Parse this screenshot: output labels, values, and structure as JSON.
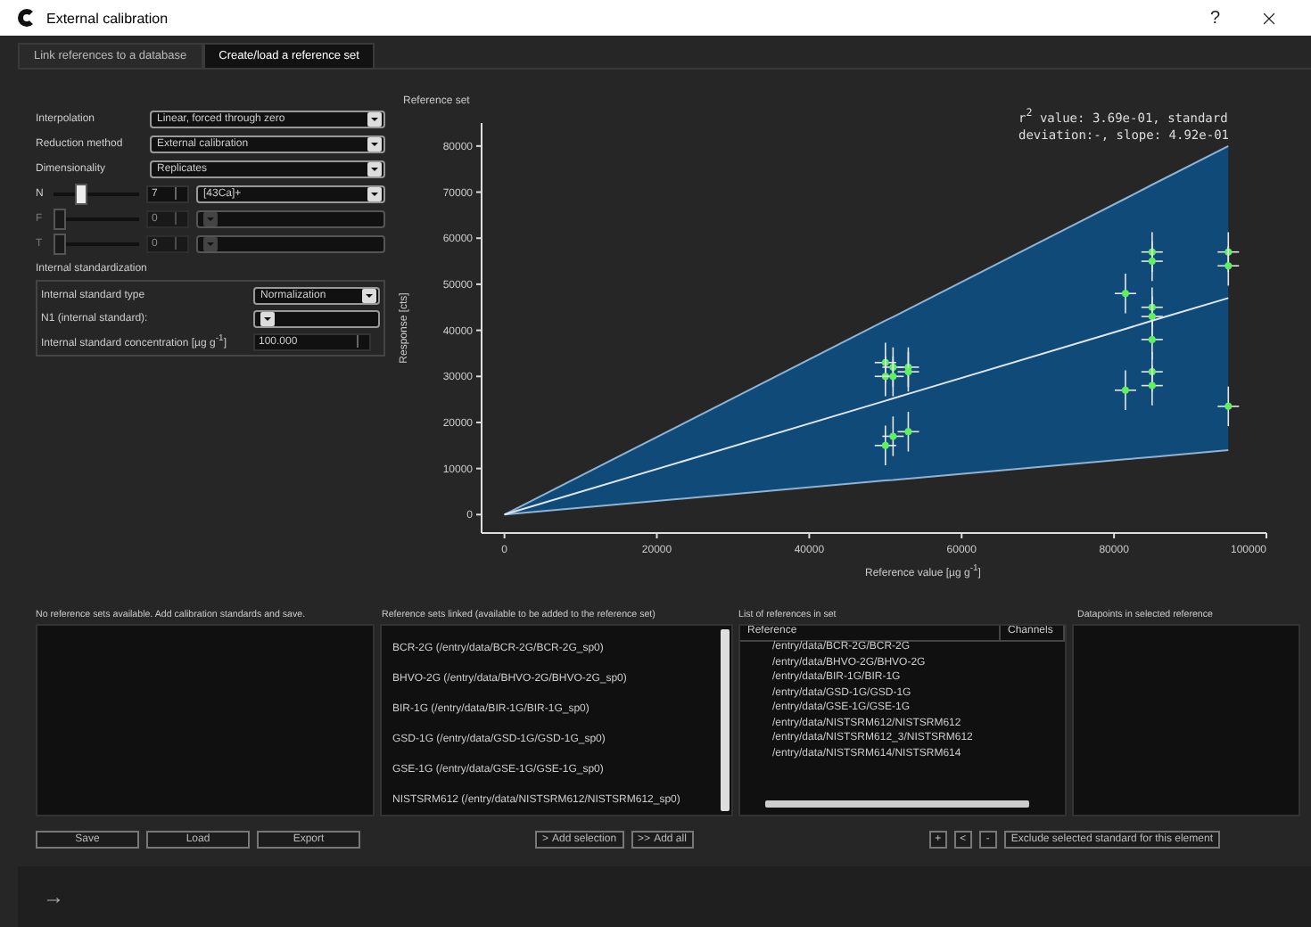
{
  "window": {
    "title": "External calibration",
    "help": "?"
  },
  "tabs": [
    {
      "label": "Link references to a database",
      "selected": false
    },
    {
      "label": "Create/load a reference set",
      "selected": true
    }
  ],
  "settings": [
    {
      "kind": "combo",
      "label": "Interpolation",
      "value": "Linear, forced through zero"
    },
    {
      "kind": "combo",
      "label": "Reduction method",
      "value": "External calibration"
    },
    {
      "kind": "combo",
      "label": "Dimensionality",
      "value": "Replicates"
    },
    {
      "kind": "slider",
      "label": "N",
      "level": 0.3,
      "spin": "7",
      "value": "[43Ca]+",
      "disabled": false
    },
    {
      "kind": "slider",
      "label": "F",
      "level": 0,
      "spin": "0",
      "disabled": true
    },
    {
      "kind": "slider",
      "label": "T",
      "level": 0,
      "spin": "0",
      "disabled": true
    }
  ],
  "internal_standardization": {
    "title": "Internal standardization",
    "rows": [
      {
        "kind": "combo",
        "label": "Internal standard type",
        "value": "Normalization"
      },
      {
        "kind": "combo",
        "label": "N1 (internal standard):"
      },
      {
        "kind": "spin",
        "label": "Internal standard concentration [µg g$^{-1}$]",
        "value": "100.000"
      }
    ]
  },
  "reference_set": {
    "title": "Reference set",
    "stats": "r$^{2}$ value: 3.69e-01, standard deviation:-, slope: 4.92e-01",
    "chart_data": {
      "type": "scatter",
      "xlabel": "Reference value [µg g$^{-1}$]",
      "ylabel": "Response [cts]",
      "x": [
        0,
        50000,
        50000,
        51000,
        51000,
        53000,
        53000,
        50000,
        51000,
        53000,
        81500,
        81500,
        85000,
        85000,
        85000,
        85000,
        85000,
        85000,
        85000,
        95000,
        95000,
        95000
      ],
      "series": [
        {
          "type": "scatter",
          "color": "#5ef05e",
          "values": [
            null,
            33000,
            30000,
            32000,
            30000,
            32000,
            31000,
            15000,
            17000,
            18000,
            48000,
            27000,
            57000,
            55000,
            45000,
            43000,
            38000,
            31000,
            28000,
            57000,
            54000,
            23500
          ],
          "errors": [
            null,
            4300,
            4300,
            4300,
            4300,
            4300,
            4300,
            4300,
            4300,
            4300,
            4300,
            4300,
            4300,
            4300,
            4300,
            4300,
            4300,
            4300,
            4300,
            4300,
            4300,
            4300
          ]
        },
        {
          "type": "line",
          "color": "#8fb3d4",
          "values": [
            0,
            42100,
            42100,
            42900,
            42900,
            44600,
            44600,
            42100,
            42900,
            44600,
            68600,
            68600,
            71600,
            71600,
            71600,
            71600,
            71600,
            71600,
            71600,
            80000,
            80000,
            80000
          ]
        },
        {
          "type": "line",
          "color": "#8fb3d4",
          "values": [
            0,
            7400,
            7400,
            7500,
            7500,
            7800,
            7800,
            7400,
            7500,
            7800,
            12000,
            12000,
            12500,
            12500,
            12500,
            12500,
            12500,
            12500,
            12500,
            14000,
            14000,
            14000
          ]
        },
        {
          "type": "line",
          "color": "#dfe6ee",
          "values": [
            0,
            24700,
            24700,
            25200,
            25200,
            26200,
            26200,
            24700,
            25200,
            26200,
            40300,
            40300,
            42100,
            42100,
            42100,
            42100,
            42100,
            42100,
            42100,
            47000,
            47000,
            47000
          ]
        }
      ],
      "xlim": [
        -3000,
        100000
      ],
      "ylim": [
        -4000,
        85000
      ],
      "xticks": [
        0,
        20000,
        40000,
        60000,
        80000,
        100000
      ],
      "yticks": [
        0,
        10000,
        20000,
        30000,
        40000,
        50000,
        60000,
        70000,
        80000
      ]
    }
  },
  "saved_sets": {
    "title": "No reference sets available. Add calibration standards and save.",
    "buttons": [
      "Save",
      "Load",
      "Export"
    ]
  },
  "linked_sets": {
    "title": "Reference sets linked (available to be added to the reference set)",
    "items": [
      "BCR-2G (/entry/data/BCR-2G/BCR-2G_sp0)",
      "BHVO-2G (/entry/data/BHVO-2G/BHVO-2G_sp0)",
      "BIR-1G (/entry/data/BIR-1G/BIR-1G_sp0)",
      "GSD-1G (/entry/data/GSD-1G/GSD-1G_sp0)",
      "GSE-1G (/entry/data/GSE-1G/GSE-1G_sp0)",
      "NISTSRM612 (/entry/data/NISTSRM612/NISTSRM612_sp0)"
    ],
    "buttons": [
      {
        "icon": ">",
        "label": "Add selection"
      },
      {
        "icon": ">>",
        "label": "Add all"
      }
    ]
  },
  "references": {
    "title": "List of references in set",
    "columns": [
      "Reference",
      "Channels"
    ],
    "items": [
      "/entry/data/BCR-2G/BCR-2G",
      "/entry/data/BHVO-2G/BHVO-2G",
      "/entry/data/BIR-1G/BIR-1G",
      "/entry/data/GSD-1G/GSD-1G",
      "/entry/data/GSE-1G/GSE-1G",
      "/entry/data/NISTSRM612/NISTSRM612",
      "/entry/data/NISTSRM612_3/NISTSRM612",
      "/entry/data/NISTSRM614/NISTSRM614"
    ],
    "buttons": [
      "+",
      "<",
      "-"
    ]
  },
  "datapoints": {
    "title": "Datapoints in selected reference",
    "button": "Exclude selected standard for this element"
  },
  "footer": {
    "arrow": "→"
  }
}
